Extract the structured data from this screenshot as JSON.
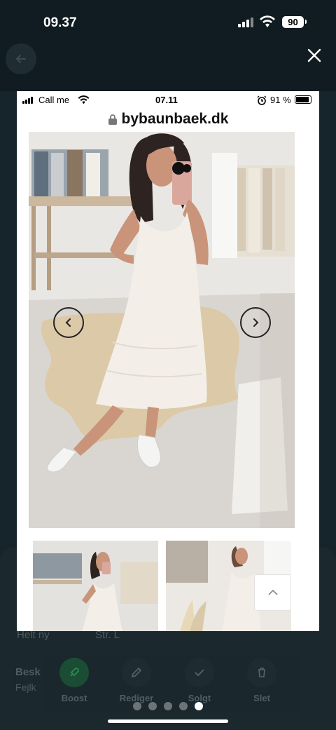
{
  "status_bar": {
    "time": "09.37",
    "battery": "90"
  },
  "background_app": {
    "condition_label": "Helt ny",
    "size_label": "Str. L",
    "description_label": "Besk",
    "description_text": "Fejlk",
    "actions": [
      {
        "label": "Boost",
        "icon": "rocket-icon"
      },
      {
        "label": "Rediger",
        "icon": "pencil-icon"
      },
      {
        "label": "Solgt",
        "icon": "check-icon"
      },
      {
        "label": "Slet",
        "icon": "trash-icon"
      }
    ]
  },
  "photo": {
    "inner_status": {
      "carrier": "Call me",
      "time": "07.11",
      "battery": "91 %"
    },
    "url": "bybaunbaek.dk"
  },
  "pager": {
    "count": 5,
    "active_index": 4
  },
  "colors": {
    "background": "#0e1a1f",
    "boost_green": "#1e8a4a",
    "dress_white": "#f4f0ea"
  }
}
